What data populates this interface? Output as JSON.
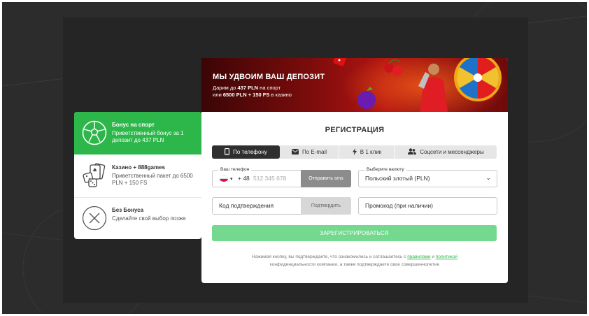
{
  "bonuses": [
    {
      "title": "Бонус на спорт",
      "desc": "Приветственный бонус за 1 депозит до 437 PLN",
      "icon": "soccer-ball-icon",
      "active": true
    },
    {
      "title": "Казино + 888games",
      "desc": "Приветственный пакет до 6500 PLN + 150 FS",
      "icon": "dice-cards-icon",
      "active": false
    },
    {
      "title": "Без Бонуса",
      "desc": "Сделайте свой выбор позже",
      "icon": "close-icon",
      "active": false
    }
  ],
  "banner": {
    "title": "МЫ УДВОИМ ВАШ ДЕПОЗИТ",
    "line1_prefix": "Дарим до ",
    "line1_bold": "437 PLN",
    "line1_suffix": " на спорт",
    "line2_prefix": "или ",
    "line2_bold": "6500 PLN + 150 FS",
    "line2_suffix": " в казино"
  },
  "registration": {
    "title": "РЕГИСТРАЦИЯ",
    "tabs": [
      {
        "label": "По телефону",
        "icon": "phone-icon",
        "active": true
      },
      {
        "label": "По E-mail",
        "icon": "envelope-icon",
        "active": false
      },
      {
        "label": "В 1 клик",
        "icon": "lightning-icon",
        "active": false
      },
      {
        "label": "Соцсети и мессенджеры",
        "icon": "users-icon",
        "active": false
      }
    ],
    "phone": {
      "label": "Ваш телефон",
      "code": "+ 48",
      "placeholder": "512 345 678",
      "button": "Отправить sms"
    },
    "currency": {
      "label": "Выберите валюту",
      "value": "Польский злотый (PLN)"
    },
    "confirm_code": {
      "placeholder": "Код подтверждения",
      "button": "Подтвердить"
    },
    "promo": {
      "placeholder": "Промокод (при наличии)"
    },
    "submit": "ЗАРЕГИСТРИРОВАТЬСЯ",
    "terms": {
      "part1": "Нажимая кнопку, вы подтверждаете, что ознакомились и соглашаетесь с ",
      "rules_link": "правилами",
      "part2": " и ",
      "policy_link": "политикой",
      "part3": " конфиденциальности компании, а также подтверждаете свое совершеннолетие"
    }
  },
  "colors": {
    "accent": "#2db74a",
    "submit": "#74d98e",
    "dark": "#2f2f2f"
  }
}
